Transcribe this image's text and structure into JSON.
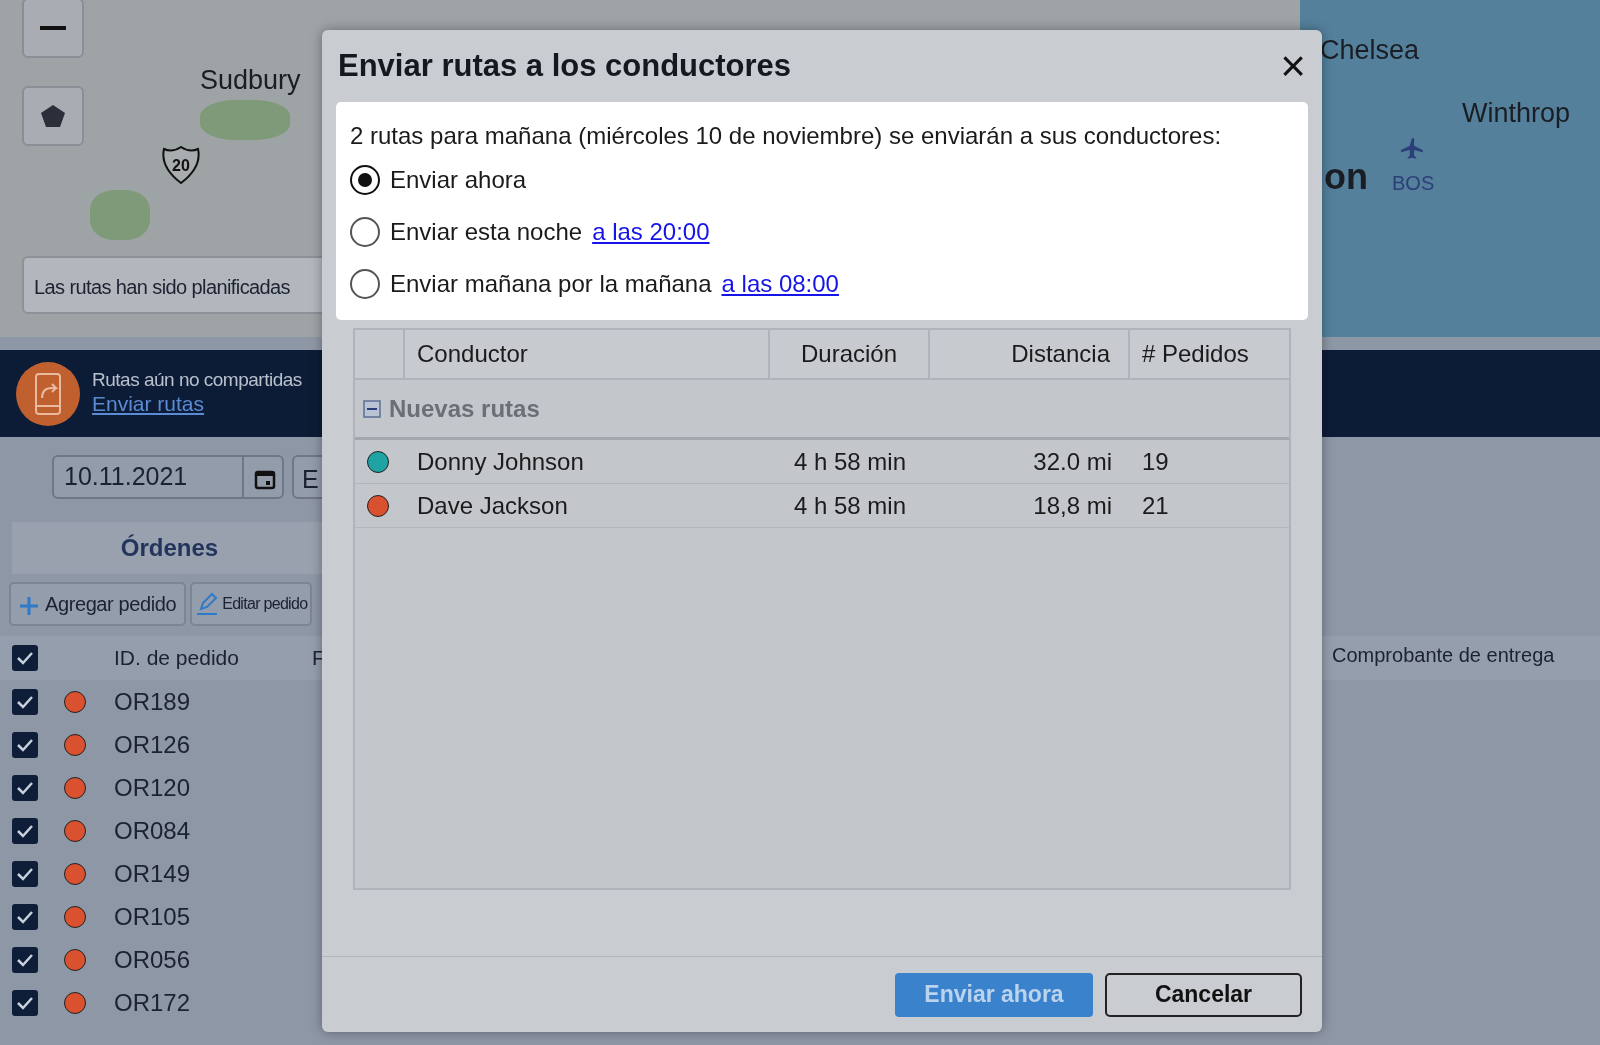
{
  "map": {
    "labels": [
      {
        "text": "Sudbury",
        "kind": "town"
      },
      {
        "text": "Chelsea",
        "kind": "town"
      },
      {
        "text": "Winthrop",
        "kind": "town"
      },
      {
        "text": "on",
        "kind": "city"
      },
      {
        "text": "BOS",
        "kind": "airport"
      }
    ],
    "shield": "20",
    "notice": "Las rutas han sido planificadas"
  },
  "banner": {
    "title": "Rutas aún no compartidas",
    "link": "Enviar rutas"
  },
  "date_field": {
    "value": "10.11.2021"
  },
  "second_field": {
    "value": "E"
  },
  "tabs": [
    {
      "label": "Órdenes",
      "selected": true
    }
  ],
  "toolbar": [
    {
      "kind": "add",
      "label": "Agregar pedido"
    },
    {
      "kind": "edit",
      "label": "Editar pedido"
    }
  ],
  "orders": {
    "header_checked": true,
    "columns": [
      "ID. de pedido",
      "F"
    ],
    "right_column": "Comprobante de entrega",
    "rows": [
      {
        "checked": true,
        "color": "#d9512e",
        "id": "OR189"
      },
      {
        "checked": true,
        "color": "#d9512e",
        "id": "OR126"
      },
      {
        "checked": true,
        "color": "#d9512e",
        "id": "OR120"
      },
      {
        "checked": true,
        "color": "#d9512e",
        "id": "OR084"
      },
      {
        "checked": true,
        "color": "#d9512e",
        "id": "OR149"
      },
      {
        "checked": true,
        "color": "#d9512e",
        "id": "OR105"
      },
      {
        "checked": true,
        "color": "#d9512e",
        "id": "OR056"
      },
      {
        "checked": true,
        "color": "#d9512e",
        "id": "OR172"
      }
    ]
  },
  "modal": {
    "title": "Enviar rutas a los conductores",
    "close": "×",
    "message": "2 rutas para mañana (miércoles 10 de noviembre) se enviarán a sus conductores:",
    "options": [
      {
        "label": "Enviar ahora",
        "selected": true
      },
      {
        "label": "Enviar esta noche",
        "link": "a las 20:00",
        "selected": false
      },
      {
        "label": "Enviar mañana por la mañana",
        "link": "a las 08:00",
        "selected": false
      }
    ],
    "columns": [
      "Conductor",
      "Duración",
      "Distancia",
      "# Pedidos"
    ],
    "group": {
      "label": "Nuevas rutas",
      "expanded": true
    },
    "rows": [
      {
        "color": "#1fa3a3",
        "driver": "Donny Johnson",
        "duration": "4 h 58 min",
        "distance": "32.0 mi",
        "orders": "19"
      },
      {
        "color": "#d9512e",
        "driver": "Dave Jackson",
        "duration": "4 h 58 min",
        "distance": "18,8 mi",
        "orders": "21"
      }
    ],
    "buttons": [
      {
        "kind": "primary",
        "label": "Enviar ahora"
      },
      {
        "kind": "secondary",
        "label": "Cancelar"
      }
    ]
  }
}
